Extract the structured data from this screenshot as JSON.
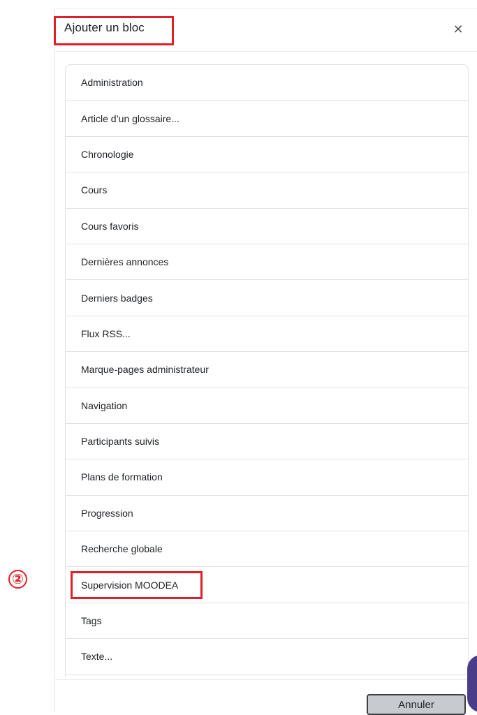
{
  "modal": {
    "title": "Ajouter un bloc",
    "close_icon": "close-icon",
    "items": [
      {
        "label": "Administration"
      },
      {
        "label": "Article d’un glossaire..."
      },
      {
        "label": "Chronologie"
      },
      {
        "label": "Cours"
      },
      {
        "label": "Cours favoris"
      },
      {
        "label": "Dernières annonces"
      },
      {
        "label": "Derniers badges"
      },
      {
        "label": "Flux RSS..."
      },
      {
        "label": "Marque-pages administrateur"
      },
      {
        "label": "Navigation"
      },
      {
        "label": "Participants suivis"
      },
      {
        "label": "Plans de formation"
      },
      {
        "label": "Progression"
      },
      {
        "label": "Recherche globale"
      },
      {
        "label": "Supervision MOODEA"
      },
      {
        "label": "Tags"
      },
      {
        "label": "Texte..."
      }
    ],
    "cancel_label": "Annuler"
  },
  "annotation": {
    "step_number": "②",
    "highlight_color": "#e02026"
  },
  "colors": {
    "side_tab": "#4b3c8a",
    "cancel_bg": "#c7cbd0"
  }
}
